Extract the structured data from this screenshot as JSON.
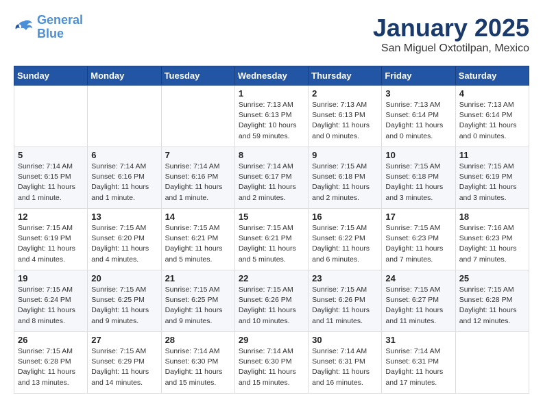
{
  "logo": {
    "line1": "General",
    "line2": "Blue"
  },
  "title": "January 2025",
  "subtitle": "San Miguel Oxtotilpan, Mexico",
  "days_header": [
    "Sunday",
    "Monday",
    "Tuesday",
    "Wednesday",
    "Thursday",
    "Friday",
    "Saturday"
  ],
  "weeks": [
    [
      {
        "day": "",
        "info": ""
      },
      {
        "day": "",
        "info": ""
      },
      {
        "day": "",
        "info": ""
      },
      {
        "day": "1",
        "info": "Sunrise: 7:13 AM\nSunset: 6:13 PM\nDaylight: 10 hours\nand 59 minutes."
      },
      {
        "day": "2",
        "info": "Sunrise: 7:13 AM\nSunset: 6:13 PM\nDaylight: 11 hours\nand 0 minutes."
      },
      {
        "day": "3",
        "info": "Sunrise: 7:13 AM\nSunset: 6:14 PM\nDaylight: 11 hours\nand 0 minutes."
      },
      {
        "day": "4",
        "info": "Sunrise: 7:13 AM\nSunset: 6:14 PM\nDaylight: 11 hours\nand 0 minutes."
      }
    ],
    [
      {
        "day": "5",
        "info": "Sunrise: 7:14 AM\nSunset: 6:15 PM\nDaylight: 11 hours\nand 1 minute."
      },
      {
        "day": "6",
        "info": "Sunrise: 7:14 AM\nSunset: 6:16 PM\nDaylight: 11 hours\nand 1 minute."
      },
      {
        "day": "7",
        "info": "Sunrise: 7:14 AM\nSunset: 6:16 PM\nDaylight: 11 hours\nand 1 minute."
      },
      {
        "day": "8",
        "info": "Sunrise: 7:14 AM\nSunset: 6:17 PM\nDaylight: 11 hours\nand 2 minutes."
      },
      {
        "day": "9",
        "info": "Sunrise: 7:15 AM\nSunset: 6:18 PM\nDaylight: 11 hours\nand 2 minutes."
      },
      {
        "day": "10",
        "info": "Sunrise: 7:15 AM\nSunset: 6:18 PM\nDaylight: 11 hours\nand 3 minutes."
      },
      {
        "day": "11",
        "info": "Sunrise: 7:15 AM\nSunset: 6:19 PM\nDaylight: 11 hours\nand 3 minutes."
      }
    ],
    [
      {
        "day": "12",
        "info": "Sunrise: 7:15 AM\nSunset: 6:19 PM\nDaylight: 11 hours\nand 4 minutes."
      },
      {
        "day": "13",
        "info": "Sunrise: 7:15 AM\nSunset: 6:20 PM\nDaylight: 11 hours\nand 4 minutes."
      },
      {
        "day": "14",
        "info": "Sunrise: 7:15 AM\nSunset: 6:21 PM\nDaylight: 11 hours\nand 5 minutes."
      },
      {
        "day": "15",
        "info": "Sunrise: 7:15 AM\nSunset: 6:21 PM\nDaylight: 11 hours\nand 5 minutes."
      },
      {
        "day": "16",
        "info": "Sunrise: 7:15 AM\nSunset: 6:22 PM\nDaylight: 11 hours\nand 6 minutes."
      },
      {
        "day": "17",
        "info": "Sunrise: 7:15 AM\nSunset: 6:23 PM\nDaylight: 11 hours\nand 7 minutes."
      },
      {
        "day": "18",
        "info": "Sunrise: 7:16 AM\nSunset: 6:23 PM\nDaylight: 11 hours\nand 7 minutes."
      }
    ],
    [
      {
        "day": "19",
        "info": "Sunrise: 7:15 AM\nSunset: 6:24 PM\nDaylight: 11 hours\nand 8 minutes."
      },
      {
        "day": "20",
        "info": "Sunrise: 7:15 AM\nSunset: 6:25 PM\nDaylight: 11 hours\nand 9 minutes."
      },
      {
        "day": "21",
        "info": "Sunrise: 7:15 AM\nSunset: 6:25 PM\nDaylight: 11 hours\nand 9 minutes."
      },
      {
        "day": "22",
        "info": "Sunrise: 7:15 AM\nSunset: 6:26 PM\nDaylight: 11 hours\nand 10 minutes."
      },
      {
        "day": "23",
        "info": "Sunrise: 7:15 AM\nSunset: 6:26 PM\nDaylight: 11 hours\nand 11 minutes."
      },
      {
        "day": "24",
        "info": "Sunrise: 7:15 AM\nSunset: 6:27 PM\nDaylight: 11 hours\nand 11 minutes."
      },
      {
        "day": "25",
        "info": "Sunrise: 7:15 AM\nSunset: 6:28 PM\nDaylight: 11 hours\nand 12 minutes."
      }
    ],
    [
      {
        "day": "26",
        "info": "Sunrise: 7:15 AM\nSunset: 6:28 PM\nDaylight: 11 hours\nand 13 minutes."
      },
      {
        "day": "27",
        "info": "Sunrise: 7:15 AM\nSunset: 6:29 PM\nDaylight: 11 hours\nand 14 minutes."
      },
      {
        "day": "28",
        "info": "Sunrise: 7:14 AM\nSunset: 6:30 PM\nDaylight: 11 hours\nand 15 minutes."
      },
      {
        "day": "29",
        "info": "Sunrise: 7:14 AM\nSunset: 6:30 PM\nDaylight: 11 hours\nand 15 minutes."
      },
      {
        "day": "30",
        "info": "Sunrise: 7:14 AM\nSunset: 6:31 PM\nDaylight: 11 hours\nand 16 minutes."
      },
      {
        "day": "31",
        "info": "Sunrise: 7:14 AM\nSunset: 6:31 PM\nDaylight: 11 hours\nand 17 minutes."
      },
      {
        "day": "",
        "info": ""
      }
    ]
  ]
}
